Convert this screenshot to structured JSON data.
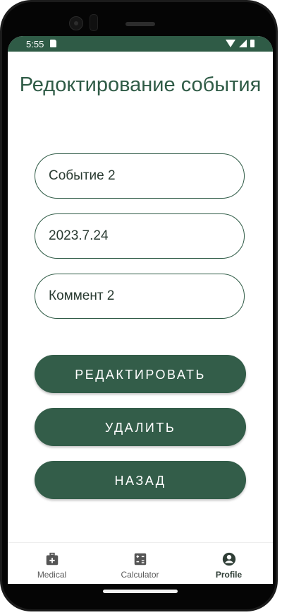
{
  "status_bar": {
    "time": "5:55",
    "background": "#2f5b46"
  },
  "screen": {
    "title": "Редоктирование события",
    "fields": {
      "event_name": "Событие 2",
      "date": "2023.7.24",
      "comment": "Коммент 2"
    },
    "buttons": {
      "edit": "РЕДАКТИРОВАТЬ",
      "delete": "УДАЛИТЬ",
      "back": "НАЗАД"
    }
  },
  "bottom_nav": {
    "items": [
      {
        "label": "Medical",
        "icon": "medical-kit-icon",
        "active": false
      },
      {
        "label": "Calculator",
        "icon": "calculator-icon",
        "active": false
      },
      {
        "label": "Profile",
        "icon": "profile-icon",
        "active": true
      }
    ]
  },
  "colors": {
    "accent": "#335d49",
    "text": "#2f5b46"
  }
}
